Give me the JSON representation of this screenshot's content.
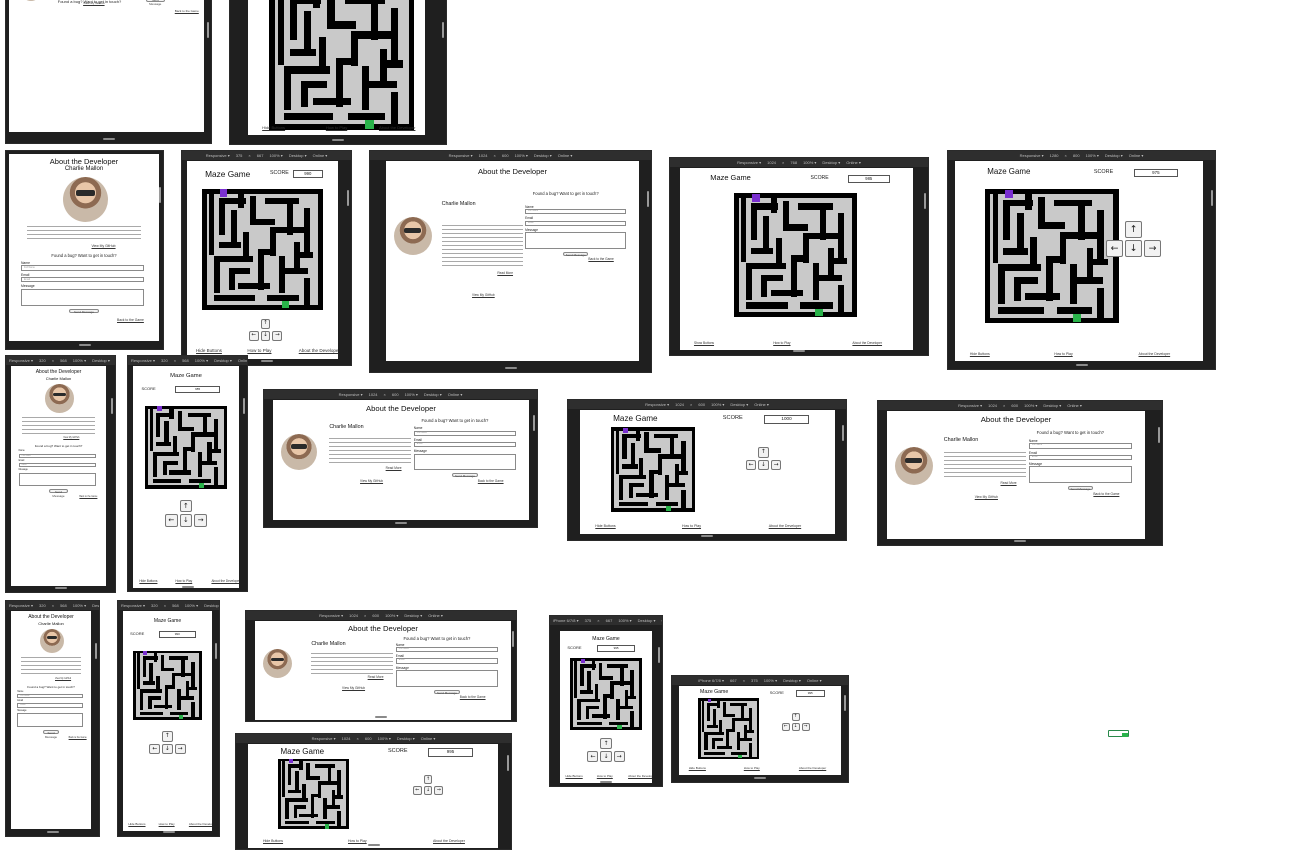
{
  "devtools_bar": {
    "mode": "Responsive ▾",
    "zoom": "100% ▾",
    "device_class": "Desktop ▾",
    "network": "Online ▾"
  },
  "maze_page": {
    "title": "Maze Game",
    "score_label": "SCORE",
    "arrow_up": "↑",
    "arrow_left": "←",
    "arrow_down": "↓",
    "arrow_right": "→",
    "hide_buttons": "Hide Buttons",
    "show_buttons": "Show Buttons",
    "how_to_play": "How to Play",
    "about_developer": "About the Developer"
  },
  "about_page": {
    "title": "About the Developer",
    "name": "Charlie Mallon",
    "bio": "Charlie is a full stack developer in training, she produced this site as a graded JavaScript project for Code Institute course. Although she is new to coding she is passionate about getting it right! She has enjoyed JavaScript and loves making games from scratch.",
    "read_more": "Read More",
    "github": "View My GitHub",
    "contact_heading": "Found a bug? Want to get in touch?",
    "name_label": "Name",
    "name_placeholder": "Full Name",
    "email_label": "Email",
    "email_placeholder": "Email",
    "message_label": "Message",
    "send_label": "Send Message",
    "back_label": "Back to the Game"
  },
  "shots": [
    {
      "id": 1,
      "kind": "about-partial"
    },
    {
      "id": 2,
      "kind": "maze-partial",
      "hide_buttons": "Hide Buttons",
      "how_to_play": "How to Play",
      "about": "About the Developer"
    },
    {
      "id": 3,
      "kind": "about",
      "device": "—",
      "w": "—",
      "h": "—"
    },
    {
      "id": 4,
      "kind": "maze",
      "device": "Responsive ▾",
      "w": "375",
      "h": "667",
      "score": "990"
    },
    {
      "id": 5,
      "kind": "about",
      "device": "Responsive ▾",
      "w": "1024",
      "h": "600"
    },
    {
      "id": 6,
      "kind": "maze",
      "device": "Responsive ▾",
      "w": "1024",
      "h": "768",
      "score": "985"
    },
    {
      "id": 7,
      "kind": "maze",
      "device": "Responsive ▾",
      "w": "1280",
      "h": "800",
      "score": "975"
    },
    {
      "id": 8,
      "kind": "about",
      "device": "Responsive ▾",
      "w": "320",
      "h": "568"
    },
    {
      "id": 9,
      "kind": "maze",
      "device": "Responsive ▾",
      "w": "320",
      "h": "568",
      "score": "985"
    },
    {
      "id": 10,
      "kind": "about",
      "device": "Responsive ▾",
      "w": "1024",
      "h": "600"
    },
    {
      "id": 11,
      "kind": "maze",
      "device": "Responsive ▾",
      "w": "1024",
      "h": "600",
      "score": "1000"
    },
    {
      "id": 12,
      "kind": "about",
      "device": "Responsive ▾",
      "w": "1024",
      "h": "600"
    },
    {
      "id": 13,
      "kind": "about",
      "device": "Responsive ▾",
      "w": "320",
      "h": "568"
    },
    {
      "id": 14,
      "kind": "maze",
      "device": "Responsive ▾",
      "w": "320",
      "h": "568",
      "score": "990"
    },
    {
      "id": 15,
      "kind": "about",
      "device": "Responsive ▾",
      "w": "1024",
      "h": "600"
    },
    {
      "id": 16,
      "kind": "maze",
      "device": "iPhone 6/7/8 ▾",
      "w": "375",
      "h": "667",
      "score": "995"
    },
    {
      "id": 17,
      "kind": "maze",
      "device": "Responsive ▾",
      "w": "1024",
      "h": "600",
      "score": "995"
    },
    {
      "id": 18,
      "kind": "maze",
      "device": "iPhone 6/7/8 ▾",
      "w": "667",
      "h": "375",
      "score": "995"
    }
  ]
}
